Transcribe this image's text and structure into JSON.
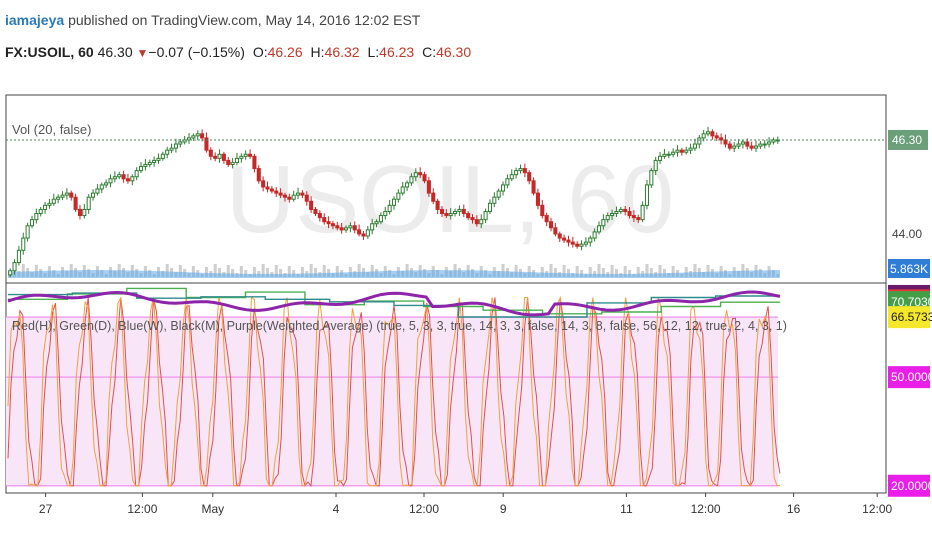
{
  "header": {
    "author": "iamajeya",
    "published_text": "published on TradingView.com, May 14, 2016 12:02 EST",
    "symbol": "FX:USOIL, 60",
    "last": "46.30",
    "change_arrow": "▼",
    "change": "−0.07 (−0.15%)",
    "o_label": "O:",
    "o_value": "46.26",
    "h_label": "H:",
    "h_value": "46.32",
    "l_label": "L:",
    "l_value": "46.23",
    "c_label": "C:",
    "c_value": "46.30"
  },
  "watermark": "USOIL, 60",
  "colors": {
    "up": "#2e7d32",
    "down": "#c62828",
    "price_badge": "#6a9f7a",
    "volume": "#5da9e9",
    "osc_orange": "#f0a040",
    "osc_red": "#e05050",
    "osc_purple": "#8e24aa",
    "osc_teal": "#2e8b8b",
    "osc_green": "#4caf50",
    "osc_blue": "#1e5aa8"
  },
  "chart_data": [
    {
      "type": "candlestick",
      "title": "",
      "annotation": "Vol (20, false)",
      "ylim": [
        42.8,
        47.4
      ],
      "y_ticks": [
        "44.00"
      ],
      "last_price": 46.3,
      "last_price_label": "46.30",
      "volume_label": "5.863K",
      "x_ticks": [
        "27",
        "12:00",
        "May",
        "4",
        "12:00",
        "9",
        "11",
        "12:00",
        "16",
        "12:00"
      ],
      "close": [
        43.1,
        43.3,
        43.6,
        43.9,
        44.2,
        44.35,
        44.5,
        44.6,
        44.7,
        44.75,
        44.85,
        44.9,
        44.95,
        45.0,
        44.9,
        44.6,
        44.45,
        44.6,
        44.9,
        45.0,
        45.1,
        45.2,
        45.25,
        45.35,
        45.4,
        45.45,
        45.35,
        45.3,
        45.4,
        45.55,
        45.65,
        45.7,
        45.75,
        45.8,
        45.85,
        45.95,
        46.05,
        46.1,
        46.2,
        46.25,
        46.3,
        46.35,
        46.4,
        46.45,
        46.35,
        46.05,
        45.9,
        45.85,
        45.95,
        45.8,
        45.7,
        45.75,
        45.85,
        45.9,
        45.95,
        45.9,
        45.6,
        45.3,
        45.15,
        45.1,
        45.05,
        45.0,
        44.95,
        44.9,
        44.85,
        44.95,
        45.0,
        44.95,
        44.8,
        44.6,
        44.5,
        44.4,
        44.3,
        44.25,
        44.2,
        44.15,
        44.1,
        44.15,
        44.2,
        44.1,
        44.0,
        43.95,
        44.1,
        44.25,
        44.3,
        44.45,
        44.55,
        44.7,
        44.85,
        45.0,
        45.15,
        45.25,
        45.4,
        45.5,
        45.45,
        45.3,
        45.0,
        44.8,
        44.6,
        44.5,
        44.45,
        44.5,
        44.55,
        44.6,
        44.5,
        44.4,
        44.35,
        44.25,
        44.35,
        44.55,
        44.75,
        44.9,
        45.05,
        45.2,
        45.35,
        45.45,
        45.55,
        45.6,
        45.5,
        45.3,
        45.0,
        44.7,
        44.45,
        44.3,
        44.15,
        44.0,
        43.9,
        43.85,
        43.8,
        43.75,
        43.7,
        43.75,
        43.8,
        43.9,
        44.05,
        44.2,
        44.35,
        44.45,
        44.5,
        44.55,
        44.6,
        44.55,
        44.45,
        44.4,
        44.35,
        44.7,
        45.2,
        45.55,
        45.8,
        45.9,
        45.95,
        45.95,
        46.0,
        46.05,
        46.0,
        46.05,
        46.1,
        46.2,
        46.35,
        46.45,
        46.5,
        46.4,
        46.35,
        46.3,
        46.2,
        46.1,
        46.15,
        46.2,
        46.25,
        46.15,
        46.1,
        46.15,
        46.2,
        46.2,
        46.25,
        46.3,
        46.3
      ]
    },
    {
      "type": "line",
      "title": "",
      "annotation": "Red(H), Green(D), Blue(W), Black(M), Purple(Weighted Average) (true, 5, 3, 3, true, 14, 3, 3, false, 14, 3, 8, false, 56, 12, 12, true, 2, 4, 3, 1)",
      "ylim": [
        18,
        76
      ],
      "y_badges": [
        {
          "label": "72.4212",
          "value": 72.4212,
          "color": "#6a1b6a"
        },
        {
          "label": "71.2029",
          "value": 71.2029,
          "color": "#e53935"
        },
        {
          "label": "70.7030",
          "value": 70.703,
          "color": "#43a047"
        },
        {
          "label": "66.5733",
          "value": 66.5733,
          "color": "#f5e72a"
        },
        {
          "label": "50.0000",
          "value": 50.0,
          "color": "#e91ee9"
        },
        {
          "label": "20.0000",
          "value": 20.0,
          "color": "#e91ee9"
        }
      ],
      "bands": [
        20,
        50,
        66.5733
      ]
    }
  ]
}
